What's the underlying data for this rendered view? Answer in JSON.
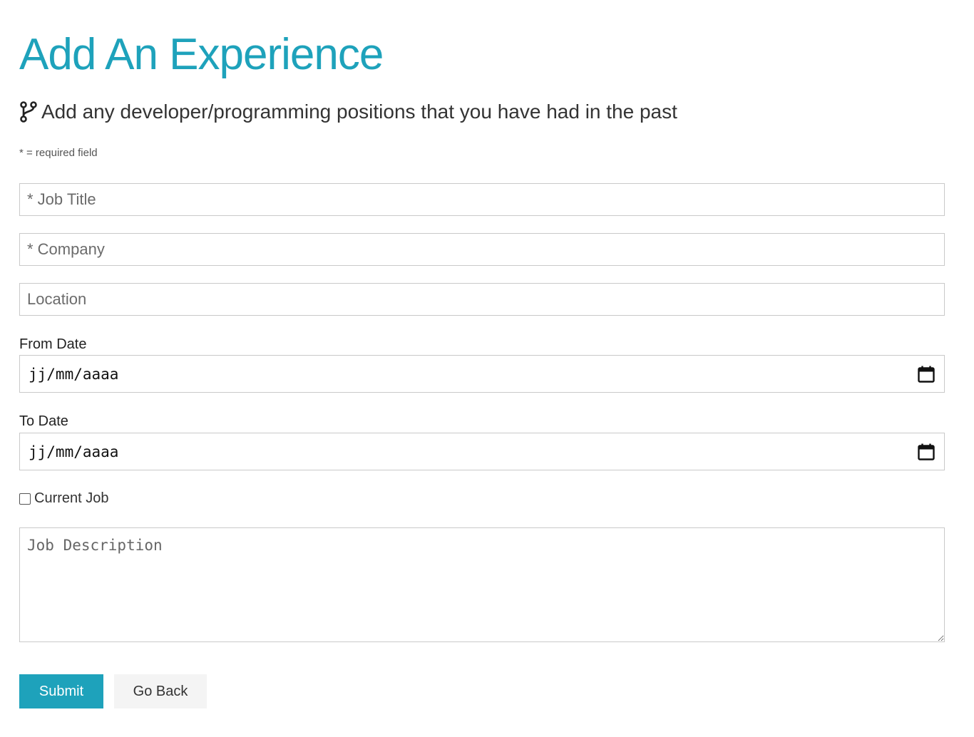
{
  "header": {
    "title": "Add An Experience",
    "lead": "Add any developer/programming positions that you have had in the past",
    "lead_icon": "code-branch-icon",
    "required_note": "* = required field"
  },
  "form": {
    "job_title": {
      "placeholder": "* Job Title",
      "value": ""
    },
    "company": {
      "placeholder": "* Company",
      "value": ""
    },
    "location": {
      "placeholder": "Location",
      "value": ""
    },
    "from_date": {
      "label": "From Date",
      "display": "jj/mm/aaaa",
      "icon": "calendar-icon"
    },
    "to_date": {
      "label": "To Date",
      "display": "jj/mm/aaaa",
      "icon": "calendar-icon"
    },
    "current_job": {
      "label": "Current Job",
      "checked": false
    },
    "description": {
      "placeholder": "Job Description",
      "value": ""
    }
  },
  "actions": {
    "submit_label": "Submit",
    "back_label": "Go Back"
  },
  "colors": {
    "accent": "#1ea2bb",
    "light_button": "#f4f4f4",
    "border": "#c9c9c9"
  }
}
